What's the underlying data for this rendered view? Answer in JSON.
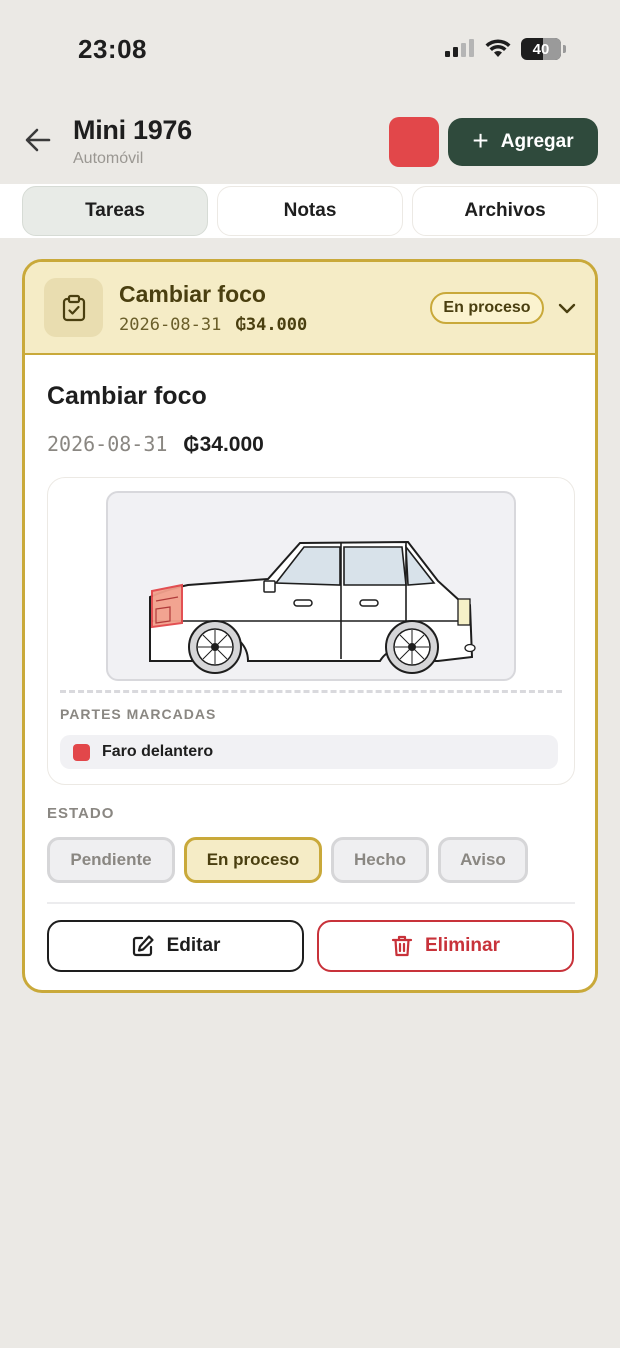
{
  "status_bar": {
    "time": "23:08",
    "battery": "40"
  },
  "header": {
    "title": "Mini 1976",
    "subtitle": "Automóvil",
    "add_label": "Agregar",
    "swatch_color": "#e2474a"
  },
  "tabs": [
    {
      "label": "Tareas",
      "active": true
    },
    {
      "label": "Notas",
      "active": false
    },
    {
      "label": "Archivos",
      "active": false
    }
  ],
  "task": {
    "title": "Cambiar foco",
    "date": "2026-08-31",
    "price": "₲34.000",
    "status": "En proceso",
    "detail_title": "Cambiar foco",
    "detail_date": "2026-08-31",
    "detail_price": "₲34.000",
    "parts_label": "PARTES MARCADAS",
    "parts": [
      {
        "label": "Faro delantero",
        "color": "#e2474a"
      }
    ],
    "estado_label": "ESTADO",
    "states": [
      {
        "label": "Pendiente",
        "active": false
      },
      {
        "label": "En proceso",
        "active": true
      },
      {
        "label": "Hecho",
        "active": false
      },
      {
        "label": "Aviso",
        "active": false
      }
    ],
    "edit_label": "Editar",
    "delete_label": "Eliminar"
  },
  "colors": {
    "accent_gold": "#c9a93a",
    "dark_green": "#2f4a3c",
    "danger": "#c8323a",
    "marked_red": "#e2474a"
  }
}
